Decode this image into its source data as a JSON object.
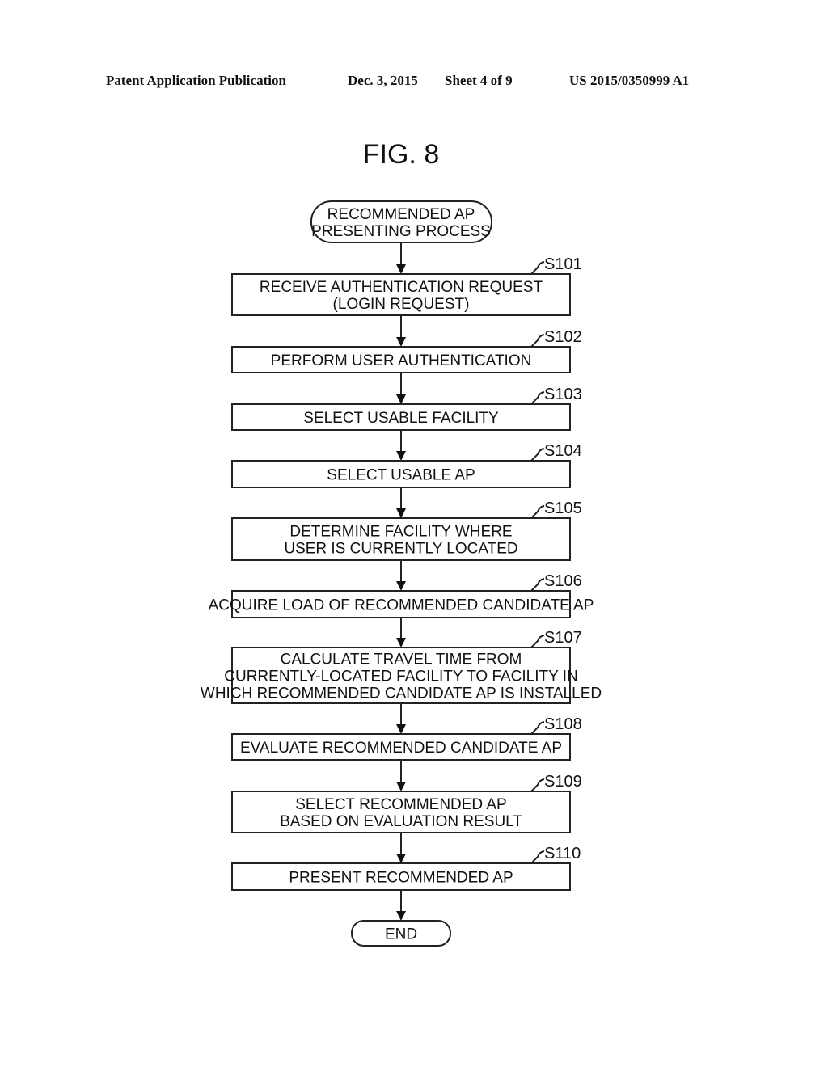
{
  "header": {
    "publication": "Patent Application Publication",
    "date": "Dec. 3, 2015",
    "sheet": "Sheet 4 of 9",
    "number": "US 2015/0350999 A1"
  },
  "figure": {
    "title": "FIG. 8",
    "start": [
      "RECOMMENDED AP",
      "PRESENTING PROCESS"
    ],
    "end": [
      "END"
    ],
    "steps": [
      {
        "id": "S101",
        "lines": [
          "RECEIVE AUTHENTICATION REQUEST",
          "(LOGIN REQUEST)"
        ]
      },
      {
        "id": "S102",
        "lines": [
          "PERFORM USER AUTHENTICATION"
        ]
      },
      {
        "id": "S103",
        "lines": [
          "SELECT USABLE FACILITY"
        ]
      },
      {
        "id": "S104",
        "lines": [
          "SELECT USABLE AP"
        ]
      },
      {
        "id": "S105",
        "lines": [
          "DETERMINE FACILITY WHERE",
          "USER IS CURRENTLY LOCATED"
        ]
      },
      {
        "id": "S106",
        "lines": [
          "ACQUIRE LOAD OF RECOMMENDED CANDIDATE AP"
        ]
      },
      {
        "id": "S107",
        "lines": [
          "CALCULATE TRAVEL TIME FROM",
          "CURRENTLY-LOCATED FACILITY TO FACILITY IN",
          "WHICH RECOMMENDED CANDIDATE AP IS INSTALLED"
        ]
      },
      {
        "id": "S108",
        "lines": [
          "EVALUATE RECOMMENDED CANDIDATE AP"
        ]
      },
      {
        "id": "S109",
        "lines": [
          "SELECT RECOMMENDED AP",
          "BASED ON EVALUATION RESULT"
        ]
      },
      {
        "id": "S110",
        "lines": [
          "PRESENT RECOMMENDED AP"
        ]
      }
    ]
  }
}
